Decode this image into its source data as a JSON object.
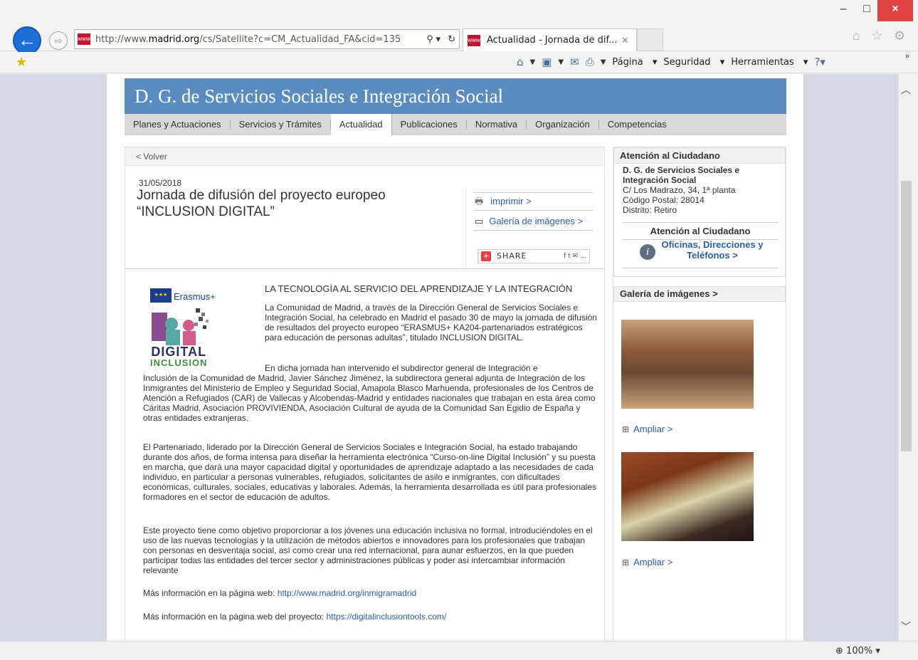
{
  "browser": {
    "url_prefix": "http://www.",
    "url_domain": "madrid.org",
    "url_rest": "/cs/Satellite?c=CM_Actualidad_FA&cid=135",
    "tab_title": "Actualidad - Jornada de dif...",
    "commands": {
      "page": "Página",
      "security": "Seguridad",
      "tools": "Herramientas"
    },
    "zoom": "100%"
  },
  "site": {
    "banner_title": "D. G. de Servicios Sociales e Integración Social",
    "menu": [
      "Planes y Actuaciones",
      "Servicios y Trámites",
      "Actualidad",
      "Publicaciones",
      "Normativa",
      "Organización",
      "Competencias"
    ]
  },
  "article": {
    "back_link": "< Volver",
    "date": "31/05/2018",
    "title": "Jornada de difusión del proyecto europeo “INCLUSION DIGITAL”",
    "print_link": "imprimir >",
    "gallery_link": "Galería de imágenes >",
    "share_label": "SHARE",
    "logo_erasmus": "Erasmus+",
    "logo_digital": "DIGITAL",
    "logo_inclusion": "INCLUSION",
    "heading": "LA TECNOLOGÌA AL SERVICIO DEL APRENDIZAJE Y LA INTEGRACIÓN",
    "p1": "La Comunidad de Madrid, a través de la Dirección General de Servicios Sociales e Integración Social,  ha celebrado en Madrid el pasado 30 de mayo la jornada de difusión de resultados del proyecto europeo “ERASMUS+ KA204-partenariados estratégicos para educación de personas adultas”, titulado INCLUSION DIGITAL.",
    "p2a": "En dicha jornada han intervenido el subdirector general de Integración e",
    "p2b": "Inclusión de la Comunidad de Madrid, Javier Sánchez Jiménez, la subdirectora general adjunta de Integración de los Inmigrantes del Ministerio de Empleo y Seguridad Social, Amapola Blasco Marhuenda,  profesionales de los Centros de Atención a Refugiados (CAR) de Vallecas y Alcobendas-Madrid y entidades nacionales que trabajan en esta área como Cáritas Madrid, Asociación PROVIVIENDA, Asociación Cultural de ayuda de la Comunidad San Egidio de España y otras entidades extranjeras.",
    "p3": "El Partenariado, liderado por la Dirección General de Servicios Sociales e Integración Social, ha estado trabajando durante dos años, de forma intensa para diseñar la herramienta electrónica “Curso-on-line Digital Inclusión”  y su puesta en marcha, que dará una mayor capacidad digital y oportunidades de aprendizaje adaptado a las necesidades de cada individuo, en particular a personas vulnerables, refugiados, solicitantes de asilo e inmigrantes, con dificultades económicas, culturales, sociales, educativas y laborales. Además, la herramienta desarrollada es útil para profesionales formadores en el sector de educación de adultos.",
    "p4": "Este proyecto tiene como objetivo proporcionar a los jóvenes una educación inclusiva no formal, introduciéndoles en el uso de las nuevas tecnologías y la utilización de métodos abiertos e innovadores para los profesionales que trabajan con personas en desventaja social, así como crear una red internacional, para aunar esfuerzos, en la que pueden participar todas las entidades del tercer sector y administraciones públicas y poder así intercambiar información relevante",
    "more1_label": "Más información en la página web: ",
    "more1_link": "http://www.madrid.org/inmigramadrid",
    "more2_label": "Más información en la página web del proyecto: ",
    "more2_link": "https://digitalinclusiontools.com/"
  },
  "sidebar": {
    "attention_title": "Atención al Ciudadano",
    "org_line1": "D. G. de Servicios Sociales e",
    "org_line2": "Integración Social",
    "address": "C/ Los Madrazo, 34, 1ª planta",
    "postal": "Código Postal: 28014",
    "district": "Distrito: Retiro",
    "attention_sub": "Atención al Ciudadano",
    "offices_link_1": "Oficinas, Direcciones y",
    "offices_link_2": "Teléfonos  >",
    "gallery_title": "Galería de imágenes >",
    "enlarge_1": "Ampliar >",
    "enlarge_2": "Ampliar >"
  }
}
